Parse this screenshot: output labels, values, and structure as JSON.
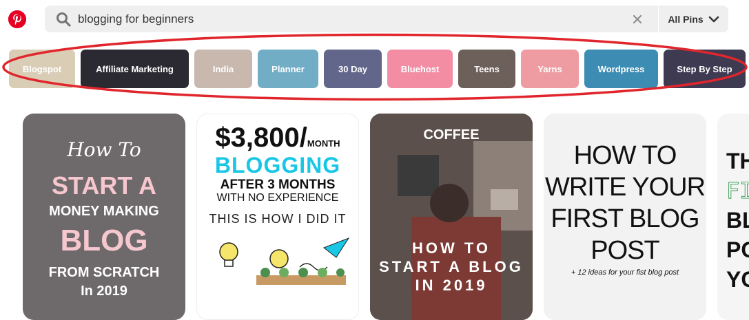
{
  "search": {
    "value": "blogging for beginners",
    "scope_label": "All Pins"
  },
  "chips": [
    {
      "label": "Blogspot",
      "color": "#d9cdb5"
    },
    {
      "label": "Affiliate Marketing",
      "color": "#2b2a33"
    },
    {
      "label": "India",
      "color": "#c8b8ae"
    },
    {
      "label": "Planner",
      "color": "#72adc6"
    },
    {
      "label": "30 Day",
      "color": "#63668b"
    },
    {
      "label": "Bluehost",
      "color": "#f28da4"
    },
    {
      "label": "Teens",
      "color": "#6d5f59"
    },
    {
      "label": "Yarns",
      "color": "#ee9ba2"
    },
    {
      "label": "Wordpress",
      "color": "#3d8cb3"
    },
    {
      "label": "Step By Step",
      "color": "#3e3a52"
    }
  ],
  "pins": {
    "pin1": {
      "script": "How To",
      "line1": "START A",
      "line2": "MONEY MAKING",
      "line3": "BLOG",
      "line4": "FROM SCRATCH",
      "line5": "In 2019"
    },
    "pin2": {
      "amount": "$3,800/",
      "per": "MONTH",
      "line2": "BLOGGING",
      "line3": "AFTER 3 MONTHS",
      "line4": "WITH NO EXPERIENCE",
      "line5": "THIS IS HOW I DID IT"
    },
    "pin3": {
      "brand": "COFFEE",
      "line1": "HOW TO",
      "line2": "START A BLOG",
      "line3": "IN 2019"
    },
    "pin4": {
      "line1": "HOW TO",
      "line2": "WRITE YOUR",
      "line3": "FIRST BLOG",
      "line4": "POST",
      "sub": "+ 12 ideas for your fist blog post"
    },
    "pin5": {
      "line1": "TH",
      "line2": "FI",
      "line3": "BL",
      "line4": "PO",
      "line5": "YO"
    }
  },
  "colors": {
    "brand": "#e60023",
    "highlight_oval": "#e0262c"
  },
  "icons": [
    "pinterest-logo",
    "search-icon",
    "clear-icon",
    "chevron-down-icon"
  ]
}
